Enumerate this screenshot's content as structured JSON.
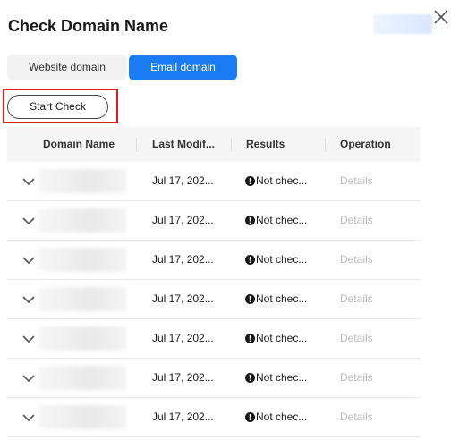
{
  "dialog": {
    "title": "Check Domain Name",
    "close_icon": "close-icon"
  },
  "tabs": [
    {
      "label": "Website domain",
      "active": false
    },
    {
      "label": "Email domain",
      "active": true
    }
  ],
  "start_check_label": "Start Check",
  "colors": {
    "accent": "#1a7cf2",
    "highlight": "#e31b1b",
    "disabled_text": "#bbbbbb"
  },
  "table": {
    "columns": [
      "Domain Name",
      "Last Modif...",
      "Results",
      "Operation"
    ],
    "rows": [
      {
        "last_modified": "Jul 17, 202...",
        "result": "Not chec...",
        "operation": "Details"
      },
      {
        "last_modified": "Jul 17, 202...",
        "result": "Not chec...",
        "operation": "Details"
      },
      {
        "last_modified": "Jul 17, 202...",
        "result": "Not chec...",
        "operation": "Details"
      },
      {
        "last_modified": "Jul 17, 202...",
        "result": "Not chec...",
        "operation": "Details"
      },
      {
        "last_modified": "Jul 17, 202...",
        "result": "Not chec...",
        "operation": "Details"
      },
      {
        "last_modified": "Jul 17, 202...",
        "result": "Not chec...",
        "operation": "Details"
      },
      {
        "last_modified": "Jul 17, 202...",
        "result": "Not chec...",
        "operation": "Details"
      }
    ]
  }
}
